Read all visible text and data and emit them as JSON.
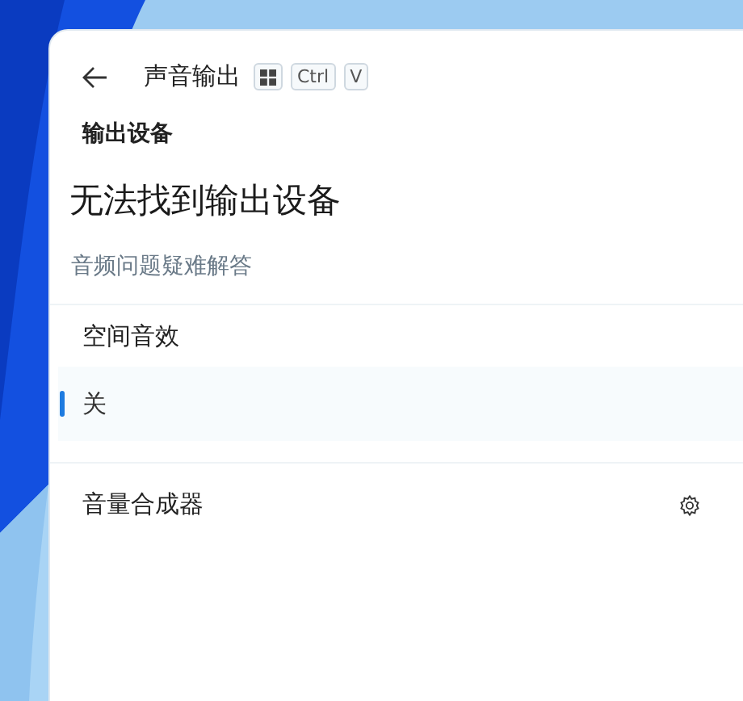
{
  "header": {
    "title": "声音输出",
    "shortcut": [
      {
        "kind": "windows"
      },
      {
        "kind": "text",
        "label": "Ctrl"
      },
      {
        "kind": "text",
        "label": "V"
      }
    ]
  },
  "output_devices": {
    "heading": "输出设备",
    "message": "无法找到输出设备",
    "troubleshoot_link": "音频问题疑难解答"
  },
  "spatial_sound": {
    "heading": "空间音效",
    "options": [
      {
        "label": "关",
        "selected": true
      }
    ]
  },
  "volume_mixer": {
    "label": "音量合成器"
  }
}
